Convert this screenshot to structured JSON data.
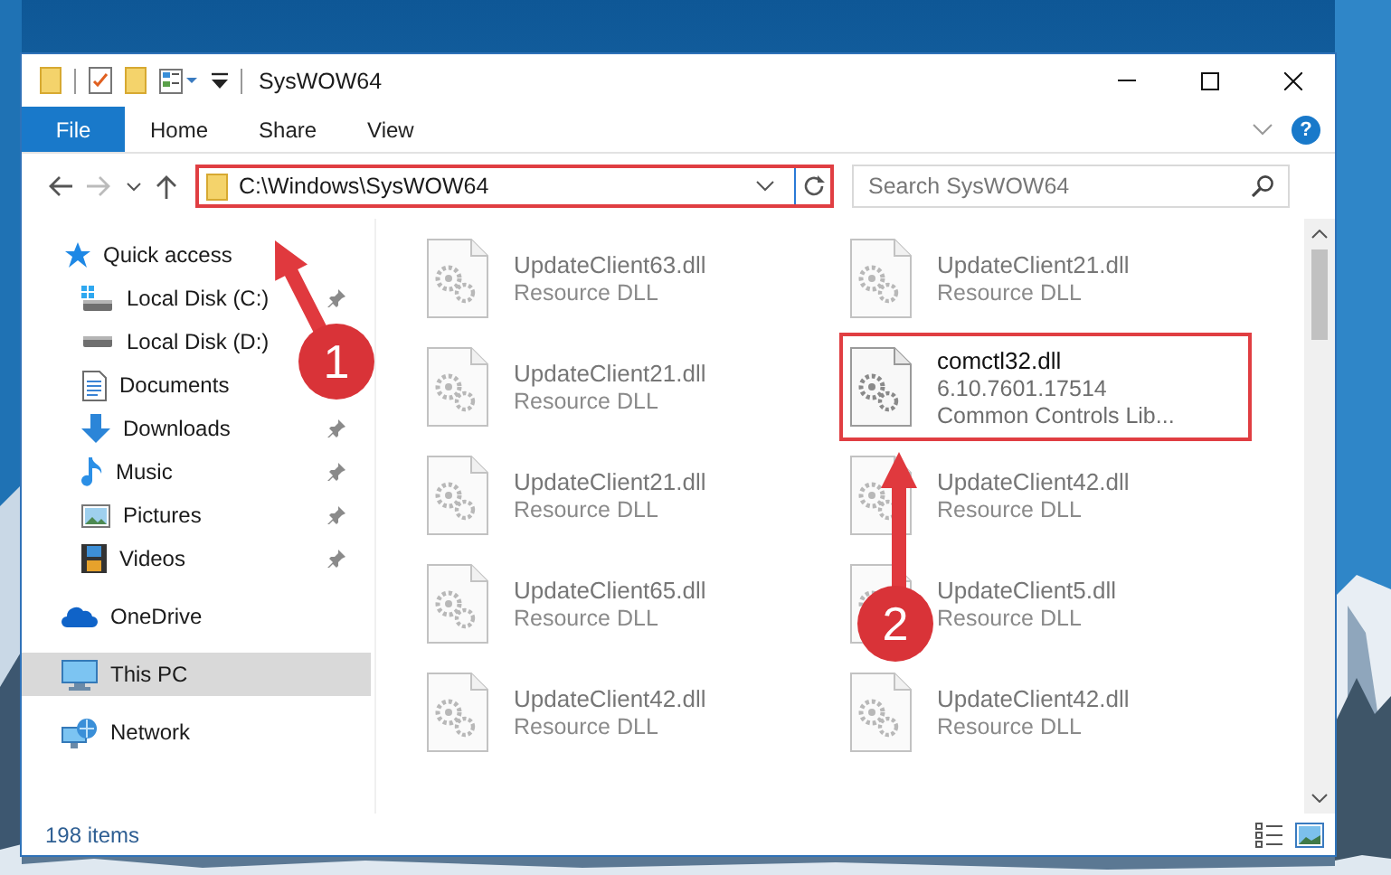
{
  "window": {
    "title": "SysWOW64"
  },
  "ribbon": {
    "tabs": [
      {
        "label": "File",
        "kind": "file",
        "selected": false
      },
      {
        "label": "Home",
        "kind": "tab",
        "selected": false
      },
      {
        "label": "Share",
        "kind": "tab",
        "selected": false
      },
      {
        "label": "View",
        "kind": "tab",
        "selected": false
      }
    ],
    "help": "?"
  },
  "address_bar": {
    "path": "C:\\Windows\\SysWOW64",
    "highlighted": true
  },
  "search": {
    "placeholder": "Search SysWOW64"
  },
  "navigation": [
    {
      "label": "Quick access",
      "kind": "quick-access",
      "selected": false,
      "children": [
        {
          "label": "Local Disk (C:)",
          "kind": "drive-c",
          "pinned": true,
          "selected": false
        },
        {
          "label": "Local Disk (D:)",
          "kind": "drive",
          "selected": false
        },
        {
          "label": "Documents",
          "kind": "documents",
          "selected": false
        },
        {
          "label": "Downloads",
          "kind": "downloads",
          "pinned": true,
          "selected": false
        },
        {
          "label": "Music",
          "kind": "music",
          "pinned": true,
          "selected": false
        },
        {
          "label": "Pictures",
          "kind": "pictures",
          "pinned": true,
          "selected": false
        },
        {
          "label": "Videos",
          "kind": "videos",
          "pinned": true,
          "selected": false
        }
      ]
    },
    {
      "label": "OneDrive",
      "kind": "cloud",
      "selected": false
    },
    {
      "label": "This PC",
      "kind": "computer",
      "selected": true
    },
    {
      "label": "Network",
      "kind": "network",
      "selected": false
    }
  ],
  "files": [
    {
      "name": "UpdateClient63.dll",
      "lines": [
        "Resource DLL"
      ],
      "blurred": true,
      "highlighted": false
    },
    {
      "name": "UpdateClient21.dll",
      "lines": [
        "Resource DLL"
      ],
      "blurred": true,
      "highlighted": false
    },
    {
      "name": "UpdateClient21.dll",
      "lines": [
        "Resource DLL"
      ],
      "blurred": true,
      "highlighted": false
    },
    {
      "name": "comctl32.dll",
      "lines": [
        "6.10.7601.17514",
        "Common Controls Lib..."
      ],
      "blurred": false,
      "highlighted": true
    },
    {
      "name": "UpdateClient21.dll",
      "lines": [
        "Resource DLL"
      ],
      "blurred": true,
      "highlighted": false
    },
    {
      "name": "UpdateClient42.dll",
      "lines": [
        "Resource DLL"
      ],
      "blurred": true,
      "highlighted": false
    },
    {
      "name": "UpdateClient65.dll",
      "lines": [
        "Resource DLL"
      ],
      "blurred": true,
      "highlighted": false
    },
    {
      "name": "UpdateClient5.dll",
      "lines": [
        "Resource DLL"
      ],
      "blurred": true,
      "highlighted": false
    },
    {
      "name": "UpdateClient42.dll",
      "lines": [
        "Resource DLL"
      ],
      "blurred": true,
      "highlighted": false
    },
    {
      "name": "UpdateClient42.dll",
      "lines": [
        "Resource DLL"
      ],
      "blurred": true,
      "highlighted": false
    }
  ],
  "status_bar": {
    "item_count": "198 items"
  },
  "annotations": [
    {
      "label": "1"
    },
    {
      "label": "2"
    }
  ]
}
